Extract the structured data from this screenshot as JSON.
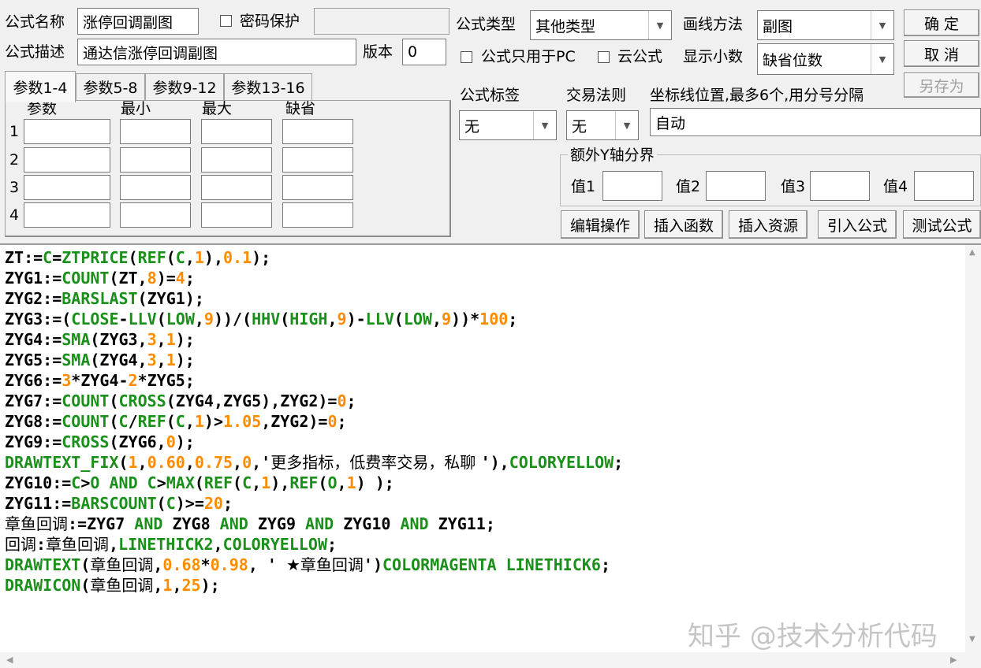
{
  "top": {
    "formula_name_label": "公式名称",
    "formula_name_value": "涨停回调副图",
    "password_label": "密码保护",
    "formula_desc_label": "公式描述",
    "formula_desc_value": "通达信涨停回调副图",
    "version_label": "版本",
    "version_value": "0",
    "formula_type_label": "公式类型",
    "formula_type_value": "其他类型",
    "draw_method_label": "画线方法",
    "draw_method_value": "副图",
    "pc_only_label": "公式只用于PC",
    "cloud_label": "云公式",
    "decimal_label": "显示小数",
    "decimal_value": "缺省位数",
    "ok_label": "确  定",
    "cancel_label": "取  消",
    "saveas_label": "另存为"
  },
  "params": {
    "tabs": [
      "参数1-4",
      "参数5-8",
      "参数9-12",
      "参数13-16"
    ],
    "headers": [
      "参数",
      "最小",
      "最大",
      "缺省"
    ],
    "rows": [
      "1",
      "2",
      "3",
      "4"
    ]
  },
  "right": {
    "tag_label": "公式标签",
    "tag_value": "无",
    "rule_label": "交易法则",
    "rule_value": "无",
    "axis_label": "坐标线位置,最多6个,用分号分隔",
    "axis_value": "自动",
    "yaxis_group_label": "额外Y轴分界",
    "v1": "值1",
    "v2": "值2",
    "v3": "值3",
    "v4": "值4"
  },
  "actions": [
    "编辑操作",
    "插入函数",
    "插入资源",
    "引入公式",
    "测试公式"
  ],
  "code_lines": [
    [
      [
        "k",
        "ZT:="
      ],
      [
        "f",
        "C"
      ],
      [
        "k",
        "="
      ],
      [
        "f",
        "ZTPRICE"
      ],
      [
        "k",
        "("
      ],
      [
        "f",
        "REF"
      ],
      [
        "k",
        "("
      ],
      [
        "f",
        "C"
      ],
      [
        "k",
        ","
      ],
      [
        "n",
        "1"
      ],
      [
        "k",
        "),"
      ],
      [
        "n",
        "0.1"
      ],
      [
        "k",
        ");"
      ]
    ],
    [
      [
        "k",
        "ZYG1:="
      ],
      [
        "f",
        "COUNT"
      ],
      [
        "k",
        "(ZT,"
      ],
      [
        "n",
        "8"
      ],
      [
        "k",
        ")="
      ],
      [
        "n",
        "4"
      ],
      [
        "k",
        ";"
      ]
    ],
    [
      [
        "k",
        "ZYG2:="
      ],
      [
        "f",
        "BARSLAST"
      ],
      [
        "k",
        "(ZYG1);"
      ]
    ],
    [
      [
        "k",
        "ZYG3:=("
      ],
      [
        "f",
        "CLOSE"
      ],
      [
        "k",
        "-"
      ],
      [
        "f",
        "LLV"
      ],
      [
        "k",
        "("
      ],
      [
        "f",
        "LOW"
      ],
      [
        "k",
        ","
      ],
      [
        "n",
        "9"
      ],
      [
        "k",
        "))/("
      ],
      [
        "f",
        "HHV"
      ],
      [
        "k",
        "("
      ],
      [
        "f",
        "HIGH"
      ],
      [
        "k",
        ","
      ],
      [
        "n",
        "9"
      ],
      [
        "k",
        ")-"
      ],
      [
        "f",
        "LLV"
      ],
      [
        "k",
        "("
      ],
      [
        "f",
        "LOW"
      ],
      [
        "k",
        ","
      ],
      [
        "n",
        "9"
      ],
      [
        "k",
        "))*"
      ],
      [
        "n",
        "100"
      ],
      [
        "k",
        ";"
      ]
    ],
    [
      [
        "k",
        "ZYG4:="
      ],
      [
        "f",
        "SMA"
      ],
      [
        "k",
        "(ZYG3,"
      ],
      [
        "n",
        "3"
      ],
      [
        "k",
        ","
      ],
      [
        "n",
        "1"
      ],
      [
        "k",
        ");"
      ]
    ],
    [
      [
        "k",
        "ZYG5:="
      ],
      [
        "f",
        "SMA"
      ],
      [
        "k",
        "(ZYG4,"
      ],
      [
        "n",
        "3"
      ],
      [
        "k",
        ","
      ],
      [
        "n",
        "1"
      ],
      [
        "k",
        ");"
      ]
    ],
    [
      [
        "k",
        "ZYG6:="
      ],
      [
        "n",
        "3"
      ],
      [
        "k",
        "*ZYG4-"
      ],
      [
        "n",
        "2"
      ],
      [
        "k",
        "*ZYG5;"
      ]
    ],
    [
      [
        "k",
        "ZYG7:="
      ],
      [
        "f",
        "COUNT"
      ],
      [
        "k",
        "("
      ],
      [
        "f",
        "CROSS"
      ],
      [
        "k",
        "(ZYG4,ZYG5),ZYG2)="
      ],
      [
        "n",
        "0"
      ],
      [
        "k",
        ";"
      ]
    ],
    [
      [
        "k",
        "ZYG8:="
      ],
      [
        "f",
        "COUNT"
      ],
      [
        "k",
        "("
      ],
      [
        "f",
        "C"
      ],
      [
        "k",
        "/"
      ],
      [
        "f",
        "REF"
      ],
      [
        "k",
        "("
      ],
      [
        "f",
        "C"
      ],
      [
        "k",
        ","
      ],
      [
        "n",
        "1"
      ],
      [
        "k",
        ")>"
      ],
      [
        "n",
        "1.05"
      ],
      [
        "k",
        ",ZYG2)="
      ],
      [
        "n",
        "0"
      ],
      [
        "k",
        ";"
      ]
    ],
    [
      [
        "k",
        "ZYG9:="
      ],
      [
        "f",
        "CROSS"
      ],
      [
        "k",
        "(ZYG6,"
      ],
      [
        "n",
        "0"
      ],
      [
        "k",
        ");"
      ]
    ],
    [
      [
        "f",
        "DRAWTEXT_FIX"
      ],
      [
        "k",
        "("
      ],
      [
        "n",
        "1"
      ],
      [
        "k",
        ","
      ],
      [
        "n",
        "0.60"
      ],
      [
        "k",
        ","
      ],
      [
        "n",
        "0.75"
      ],
      [
        "k",
        ","
      ],
      [
        "n",
        "0"
      ],
      [
        "k",
        ",'"
      ],
      [
        "s",
        "更多指标，低费率交易，私聊 "
      ],
      [
        "k",
        "'),"
      ],
      [
        "f",
        "COLORYELLOW"
      ],
      [
        "k",
        ";"
      ]
    ],
    [
      [
        "k",
        "ZYG10:="
      ],
      [
        "f",
        "C"
      ],
      [
        "k",
        ">"
      ],
      [
        "f",
        "O"
      ],
      [
        "k",
        " "
      ],
      [
        "f",
        "AND"
      ],
      [
        "k",
        " "
      ],
      [
        "f",
        "C"
      ],
      [
        "k",
        ">"
      ],
      [
        "f",
        "MAX"
      ],
      [
        "k",
        "("
      ],
      [
        "f",
        "REF"
      ],
      [
        "k",
        "("
      ],
      [
        "f",
        "C"
      ],
      [
        "k",
        ","
      ],
      [
        "n",
        "1"
      ],
      [
        "k",
        "),"
      ],
      [
        "f",
        "REF"
      ],
      [
        "k",
        "("
      ],
      [
        "f",
        "O"
      ],
      [
        "k",
        ","
      ],
      [
        "n",
        "1"
      ],
      [
        "k",
        ") );"
      ]
    ],
    [
      [
        "k",
        "ZYG11:="
      ],
      [
        "f",
        "BARSCOUNT"
      ],
      [
        "k",
        "("
      ],
      [
        "f",
        "C"
      ],
      [
        "k",
        ")>="
      ],
      [
        "n",
        "20"
      ],
      [
        "k",
        ";"
      ]
    ],
    [
      [
        "c",
        "章鱼回调"
      ],
      [
        "k",
        ":=ZYG7 "
      ],
      [
        "f",
        "AND"
      ],
      [
        "k",
        " ZYG8 "
      ],
      [
        "f",
        "AND"
      ],
      [
        "k",
        " ZYG9 "
      ],
      [
        "f",
        "AND"
      ],
      [
        "k",
        " ZYG10 "
      ],
      [
        "f",
        "AND"
      ],
      [
        "k",
        " ZYG11;"
      ]
    ],
    [
      [
        "c",
        "回调"
      ],
      [
        "k",
        ":"
      ],
      [
        "c",
        "章鱼回调"
      ],
      [
        "k",
        ","
      ],
      [
        "f",
        "LINETHICK2"
      ],
      [
        "k",
        ","
      ],
      [
        "f",
        "COLORYELLOW"
      ],
      [
        "k",
        ";"
      ]
    ],
    [
      [
        "f",
        "DRAWTEXT"
      ],
      [
        "k",
        "("
      ],
      [
        "c",
        "章鱼回调"
      ],
      [
        "k",
        ","
      ],
      [
        "n",
        "0.68"
      ],
      [
        "k",
        "*"
      ],
      [
        "n",
        "0.98"
      ],
      [
        "k",
        ", ' "
      ],
      [
        "s",
        "★章鱼回调"
      ],
      [
        "k",
        "')"
      ],
      [
        "f",
        "COLORMAGENTA"
      ],
      [
        "k",
        " "
      ],
      [
        "f",
        "LINETHICK6"
      ],
      [
        "k",
        ";"
      ]
    ],
    [
      [
        "f",
        "DRAWICON"
      ],
      [
        "k",
        "("
      ],
      [
        "c",
        "章鱼回调"
      ],
      [
        "k",
        ","
      ],
      [
        "n",
        "1"
      ],
      [
        "k",
        ","
      ],
      [
        "n",
        "25"
      ],
      [
        "k",
        ");"
      ]
    ]
  ],
  "watermark": "知乎 @技术分析代码",
  "colors": {
    "keyword": "#000000",
    "function": "#1a8f1a",
    "number": "#ff8c00"
  }
}
